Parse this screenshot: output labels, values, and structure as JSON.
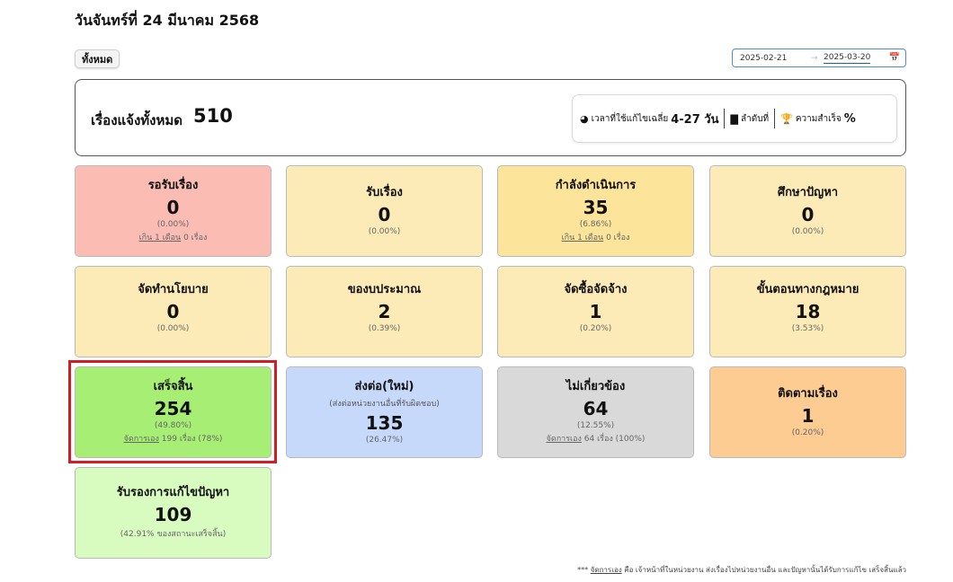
{
  "page": {
    "title": "วันจันทร์ที่ 24 มีนาคม 2568"
  },
  "filter": {
    "all_label": "ทั้งหมด",
    "date_from": "2025-02-21",
    "arrow": "→",
    "date_to": "2025-03-20"
  },
  "summary": {
    "label": "เรื่องแจ้งทั้งหมด",
    "total": "510",
    "avg_time_label": "เวลาที่ใช้แก้ไขเฉลี่ย",
    "avg_time_value": "4-27 วัน",
    "rank_label": "ลำดับที่",
    "success_label": "ความสำเร็จ",
    "success_value": "%"
  },
  "cards": [
    {
      "title": "รอรับเรื่อง",
      "count": "0",
      "percent": "(0.00%)",
      "extra_link": "เกิน 1 เดือน",
      "extra_text": " 0 เรื่อง"
    },
    {
      "title": "รับเรื่อง",
      "count": "0",
      "percent": "(0.00%)"
    },
    {
      "title": "กำลังดำเนินการ",
      "count": "35",
      "percent": "(6.86%)",
      "extra_link": "เกิน 1 เดือน",
      "extra_text": " 0 เรื่อง"
    },
    {
      "title": "ศึกษาปัญหา",
      "count": "0",
      "percent": "(0.00%)"
    },
    {
      "title": "จัดทำนโยบาย",
      "count": "0",
      "percent": "(0.00%)"
    },
    {
      "title": "ของบประมาณ",
      "count": "2",
      "percent": "(0.39%)"
    },
    {
      "title": "จัดซื้อจัดจ้าง",
      "count": "1",
      "percent": "(0.20%)"
    },
    {
      "title": "ขั้นตอนทางกฎหมาย",
      "count": "18",
      "percent": "(3.53%)"
    },
    {
      "title": "เสร็จสิ้น",
      "count": "254",
      "percent": "(49.80%)",
      "extra_link": "จัดการเอง",
      "extra_text": " 199 เรื่อง (78%)"
    },
    {
      "title": "ส่งต่อ(ใหม่)",
      "subtitle": "(ส่งต่อหน่วยงานอื่นที่รับผิดชอบ)",
      "count": "135",
      "percent": "(26.47%)"
    },
    {
      "title": "ไม่เกี่ยวข้อง",
      "count": "64",
      "percent": "(12.55%)",
      "extra_link": "จัดการเอง",
      "extra_text": " 64 เรื่อง (100%)"
    },
    {
      "title": "ติดตามเรื่อง",
      "count": "1",
      "percent": "(0.20%)"
    },
    {
      "title": "รับรองการแก้ไขปัญหา",
      "count": "109",
      "percent": "(42.91% ของสถานะเสร็จสิ้น)"
    }
  ],
  "footnote": {
    "prefix": "*** ",
    "link": "จัดการเอง",
    "text": " คือ เจ้าหน้าที่ในหน่วยงาน ส่งเรื่องไปหน่วยงานอื่น และปัญหานั้นได้รับการแก้ไข เสร็จสิ้นแล้ว"
  }
}
